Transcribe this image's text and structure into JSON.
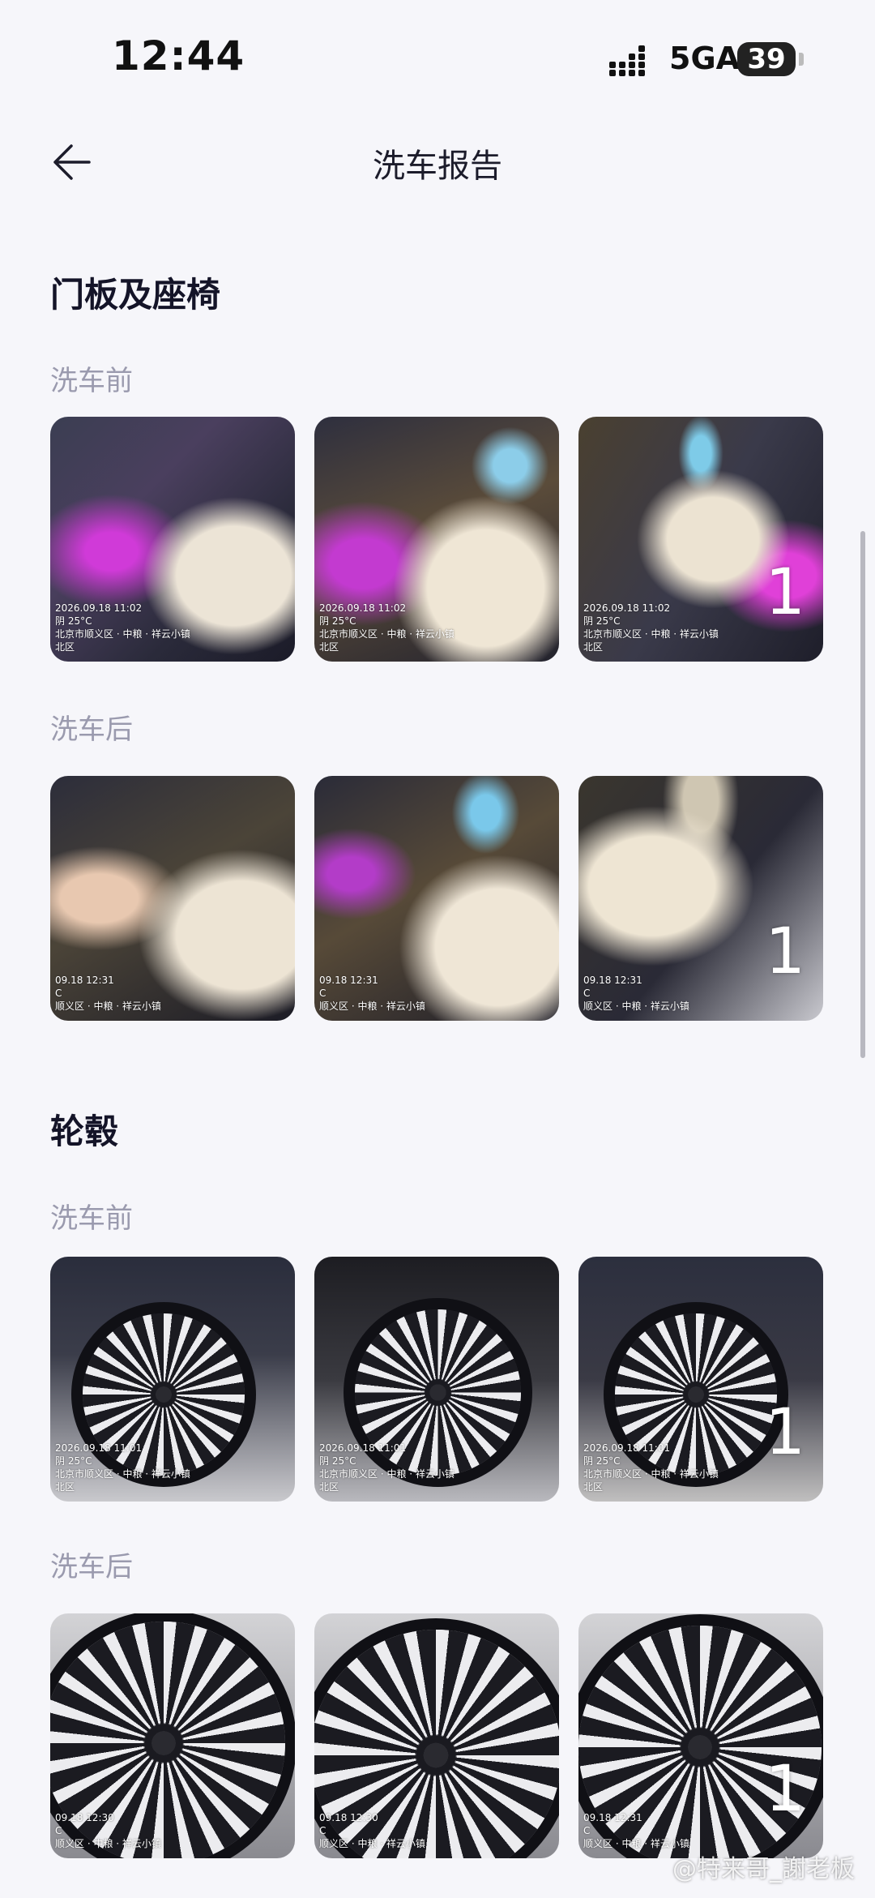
{
  "status_bar": {
    "time": "12:44",
    "network": "5GA",
    "battery": "39"
  },
  "nav": {
    "title": "洗车报告"
  },
  "sections": [
    {
      "title": "门板及座椅",
      "groups": [
        {
          "label": "洗车前",
          "photos": [
            {
              "stamp": "2026.09.18 11:02\n阴 25°C\n北京市顺义区 · 中粮 · 祥云小镇\n北区",
              "count": ""
            },
            {
              "stamp": "2026.09.18 11:02\n阴 25°C\n北京市顺义区 · 中粮 · 祥云小镇\n北区",
              "count": ""
            },
            {
              "stamp": "2026.09.18 11:02\n阴 25°C\n北京市顺义区 · 中粮 · 祥云小镇\n北区",
              "count": "1"
            }
          ]
        },
        {
          "label": "洗车后",
          "photos": [
            {
              "stamp": "09.18 12:31\nC\n顺义区 · 中粮 · 祥云小镇",
              "count": ""
            },
            {
              "stamp": "09.18 12:31\nC\n顺义区 · 中粮 · 祥云小镇",
              "count": ""
            },
            {
              "stamp": "09.18 12:31\nC\n顺义区 · 中粮 · 祥云小镇",
              "count": "1"
            }
          ]
        }
      ]
    },
    {
      "title": "轮毂",
      "groups": [
        {
          "label": "洗车前",
          "photos": [
            {
              "stamp": "2026.09.18 11:01\n阴 25°C\n北京市顺义区 · 中粮 · 祥云小镇\n北区",
              "count": ""
            },
            {
              "stamp": "2026.09.18 11:01\n阴 25°C\n北京市顺义区 · 中粮 · 祥云小镇\n北区",
              "count": ""
            },
            {
              "stamp": "2026.09.18 11:01\n阴 25°C\n北京市顺义区 · 中粮 · 祥云小镇\n北区",
              "count": "1"
            }
          ]
        },
        {
          "label": "洗车后",
          "photos": [
            {
              "stamp": "09.18 12:30\nC\n顺义区 · 中粮 · 祥云小镇",
              "count": ""
            },
            {
              "stamp": "09.18 12:30\nC\n顺义区 · 中粮 · 祥云小镇",
              "count": ""
            },
            {
              "stamp": "09.18 12:31\nC\n顺义区 · 中粮 · 祥云小镇",
              "count": "1"
            }
          ]
        }
      ]
    }
  ],
  "watermark": "@特来哥_謝老板"
}
